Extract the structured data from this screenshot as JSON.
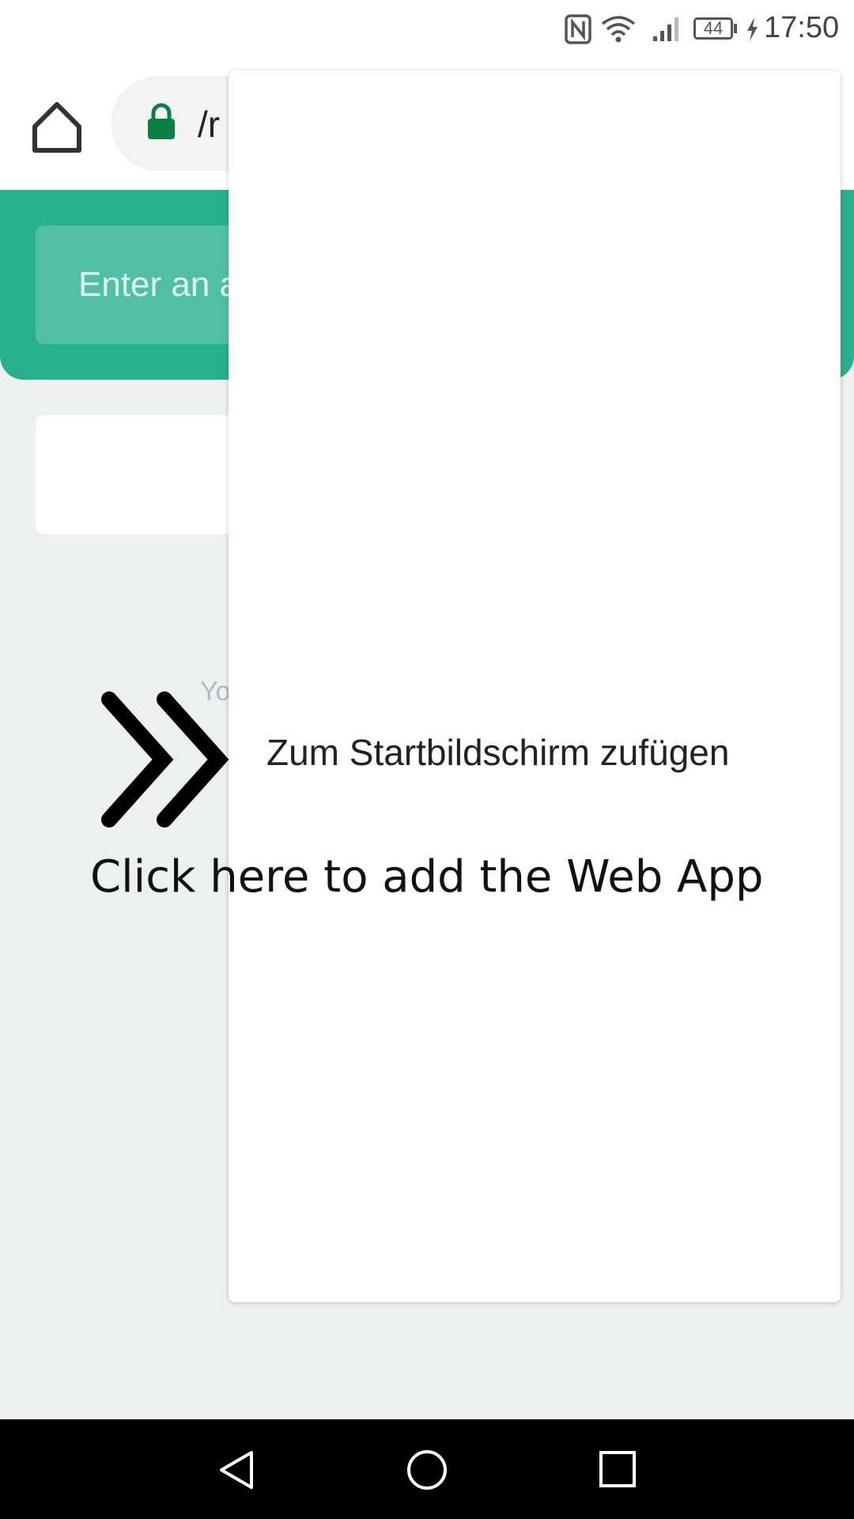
{
  "status_bar": {
    "battery_level": "44",
    "time": "17:50"
  },
  "browser": {
    "url_text": "/r"
  },
  "page": {
    "address_placeholder": "Enter an a",
    "faded_text": "Yo"
  },
  "menu": {
    "items": [
      {
        "label": "Zum Startbildschirm zufügen"
      }
    ]
  },
  "overlay": {
    "hint_text": "Click here to add the Web App"
  },
  "colors": {
    "accent": "#26b08f",
    "lock": "#0b8043",
    "page_background": "#ecf0f1"
  }
}
